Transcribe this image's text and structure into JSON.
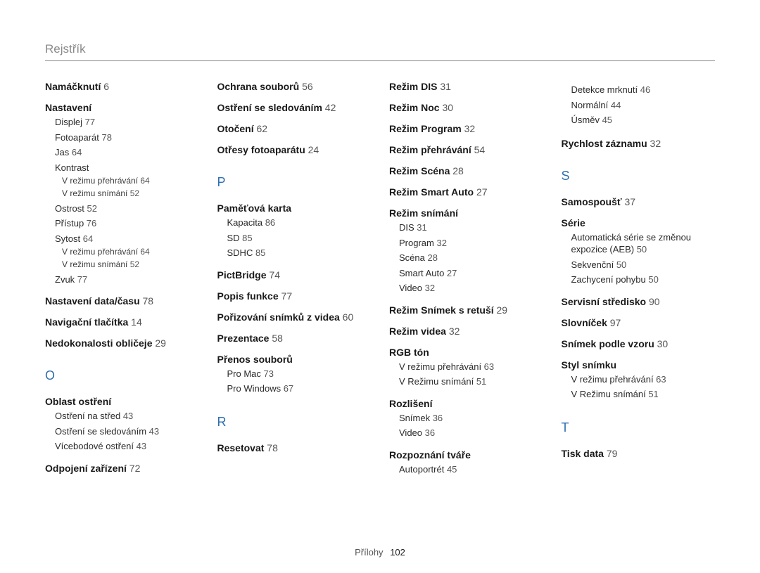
{
  "header": "Rejstřík",
  "footer": {
    "label": "Přílohy",
    "page": "102"
  },
  "columns": [
    [
      {
        "t": "main",
        "text": "Namáčknutí",
        "pg": "6"
      },
      {
        "t": "main",
        "text": "Nastavení",
        "children": [
          {
            "t": "sub",
            "text": "Displej",
            "pg": "77"
          },
          {
            "t": "sub",
            "text": "Fotoaparát",
            "pg": "78"
          },
          {
            "t": "sub",
            "text": "Jas",
            "pg": "64"
          },
          {
            "t": "sub",
            "text": "Kontrast",
            "children": [
              {
                "t": "subsub",
                "text": "V režimu přehrávání",
                "pg": "64"
              },
              {
                "t": "subsub",
                "text": "V režimu snímání",
                "pg": "52"
              }
            ]
          },
          {
            "t": "sub",
            "text": "Ostrost",
            "pg": "52"
          },
          {
            "t": "sub",
            "text": "Přístup",
            "pg": "76"
          },
          {
            "t": "sub",
            "text": "Sytost",
            "pg": "64",
            "children": [
              {
                "t": "subsub",
                "text": "V režimu přehrávání",
                "pg": "64"
              },
              {
                "t": "subsub",
                "text": "V režimu snímání",
                "pg": "52"
              }
            ]
          },
          {
            "t": "sub",
            "text": "Zvuk",
            "pg": "77"
          }
        ]
      },
      {
        "t": "main",
        "text": "Nastavení data/času",
        "pg": "78"
      },
      {
        "t": "main",
        "text": "Navigační tlačítka",
        "pg": "14"
      },
      {
        "t": "main",
        "text": "Nedokonalosti obličeje",
        "pg": "29"
      },
      {
        "t": "letter",
        "text": "O"
      },
      {
        "t": "main",
        "text": "Oblast ostření",
        "children": [
          {
            "t": "sub",
            "text": "Ostření na střed",
            "pg": "43"
          },
          {
            "t": "sub",
            "text": "Ostření se sledováním",
            "pg": "43"
          },
          {
            "t": "sub",
            "text": "Vícebodové ostření",
            "pg": "43"
          }
        ]
      },
      {
        "t": "main",
        "text": "Odpojení zařízení",
        "pg": "72"
      }
    ],
    [
      {
        "t": "main",
        "text": "Ochrana souborů",
        "pg": "56"
      },
      {
        "t": "main",
        "text": "Ostření se sledováním",
        "pg": "42"
      },
      {
        "t": "main",
        "text": "Otočení",
        "pg": "62"
      },
      {
        "t": "main",
        "text": "Otřesy fotoaparátu",
        "pg": "24"
      },
      {
        "t": "letter",
        "text": "P"
      },
      {
        "t": "main",
        "text": "Paměťová karta",
        "children": [
          {
            "t": "sub",
            "text": "Kapacita",
            "pg": "86"
          },
          {
            "t": "sub",
            "text": "SD",
            "pg": "85"
          },
          {
            "t": "sub",
            "text": "SDHC",
            "pg": "85"
          }
        ]
      },
      {
        "t": "main",
        "text": "PictBridge",
        "pg": "74"
      },
      {
        "t": "main",
        "text": "Popis funkce",
        "pg": "77"
      },
      {
        "t": "main",
        "text": "Pořizování snímků z videa",
        "pg": "60"
      },
      {
        "t": "main",
        "text": "Prezentace",
        "pg": "58"
      },
      {
        "t": "main",
        "text": "Přenos souborů",
        "children": [
          {
            "t": "sub",
            "text": "Pro Mac",
            "pg": "73"
          },
          {
            "t": "sub",
            "text": "Pro Windows",
            "pg": "67"
          }
        ]
      },
      {
        "t": "letter",
        "text": "R"
      },
      {
        "t": "main",
        "text": "Resetovat",
        "pg": "78"
      }
    ],
    [
      {
        "t": "main",
        "text": "Režim DIS",
        "pg": "31"
      },
      {
        "t": "main",
        "text": "Režim Noc",
        "pg": "30"
      },
      {
        "t": "main",
        "text": "Režim Program",
        "pg": "32"
      },
      {
        "t": "main",
        "text": "Režim přehrávání",
        "pg": "54"
      },
      {
        "t": "main",
        "text": "Režim Scéna",
        "pg": "28"
      },
      {
        "t": "main",
        "text": "Režim Smart Auto",
        "pg": "27"
      },
      {
        "t": "main",
        "text": "Režim snímání",
        "children": [
          {
            "t": "sub",
            "text": "DIS",
            "pg": "31"
          },
          {
            "t": "sub",
            "text": "Program",
            "pg": "32"
          },
          {
            "t": "sub",
            "text": "Scéna",
            "pg": "28"
          },
          {
            "t": "sub",
            "text": "Smart Auto",
            "pg": "27"
          },
          {
            "t": "sub",
            "text": "Video",
            "pg": "32"
          }
        ]
      },
      {
        "t": "main",
        "text": "Režim Snímek s retuší",
        "pg": "29"
      },
      {
        "t": "main",
        "text": "Režim videa",
        "pg": "32"
      },
      {
        "t": "main",
        "text": "RGB tón",
        "children": [
          {
            "t": "sub",
            "text": "V režimu přehrávání",
            "pg": "63"
          },
          {
            "t": "sub",
            "text": "V Režimu snímání",
            "pg": "51"
          }
        ]
      },
      {
        "t": "main",
        "text": "Rozlišení",
        "children": [
          {
            "t": "sub",
            "text": "Snímek",
            "pg": "36"
          },
          {
            "t": "sub",
            "text": "Video",
            "pg": "36"
          }
        ]
      },
      {
        "t": "main",
        "text": "Rozpoznání tváře",
        "children": [
          {
            "t": "sub",
            "text": "Autoportrét",
            "pg": "45"
          }
        ]
      }
    ],
    [
      {
        "t": "sub",
        "text": "Detekce mrknutí",
        "pg": "46",
        "flush": true
      },
      {
        "t": "sub",
        "text": "Normální",
        "pg": "44",
        "flush": true
      },
      {
        "t": "sub",
        "text": "Úsměv",
        "pg": "45",
        "flush": true
      },
      {
        "t": "main",
        "text": "Rychlost záznamu",
        "pg": "32",
        "gapTop": true
      },
      {
        "t": "letter",
        "text": "S"
      },
      {
        "t": "main",
        "text": "Samospoušť",
        "pg": "37"
      },
      {
        "t": "main",
        "text": "Série",
        "children": [
          {
            "t": "sub",
            "text": "Automatická série se změnou expozice (AEB)",
            "pg": "50"
          },
          {
            "t": "sub",
            "text": "Sekvenční",
            "pg": "50"
          },
          {
            "t": "sub",
            "text": "Zachycení pohybu",
            "pg": "50"
          }
        ]
      },
      {
        "t": "main",
        "text": "Servisní středisko",
        "pg": "90"
      },
      {
        "t": "main",
        "text": "Slovníček",
        "pg": "97"
      },
      {
        "t": "main",
        "text": "Snímek podle vzoru",
        "pg": "30"
      },
      {
        "t": "main",
        "text": "Styl snímku",
        "children": [
          {
            "t": "sub",
            "text": "V režimu přehrávání",
            "pg": "63"
          },
          {
            "t": "sub",
            "text": "V Režimu snímání",
            "pg": "51"
          }
        ]
      },
      {
        "t": "letter",
        "text": "T"
      },
      {
        "t": "main",
        "text": "Tisk data",
        "pg": "79"
      }
    ]
  ]
}
